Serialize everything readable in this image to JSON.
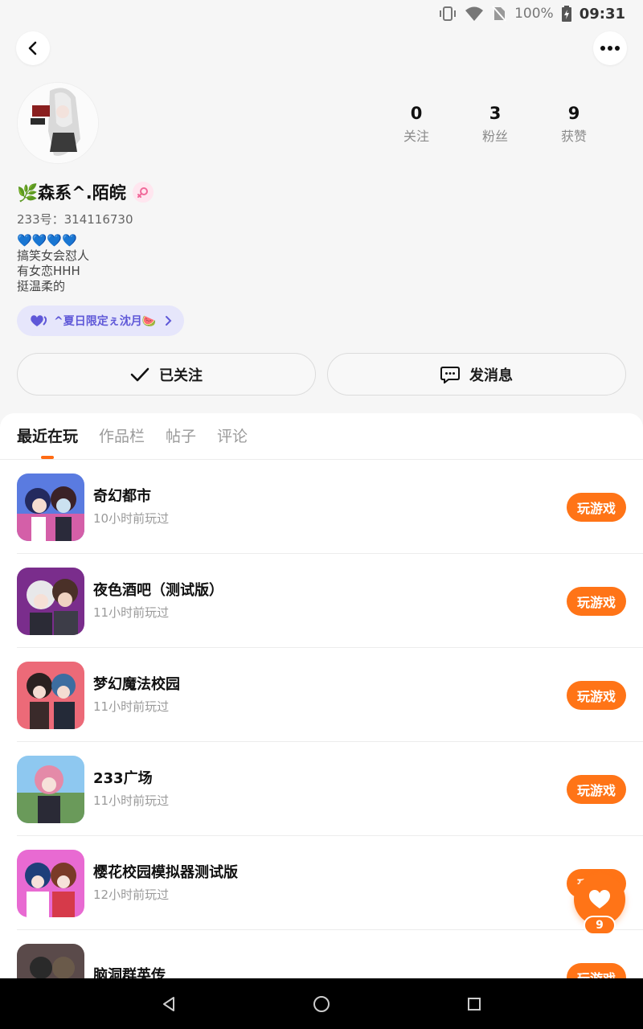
{
  "status_bar": {
    "battery": "100%",
    "time": "09:31"
  },
  "profile": {
    "nickname": "🌿森系^.陌皖",
    "uid": "233号：314116730",
    "bio_emoji": "💙💙💙💙",
    "bio_lines": [
      "搞笑女会怼人",
      "有女恋HHH",
      "挺温柔的"
    ],
    "tag": "^夏日限定ぇ沈月🍉",
    "stats": [
      {
        "num": "0",
        "label": "关注"
      },
      {
        "num": "3",
        "label": "粉丝"
      },
      {
        "num": "9",
        "label": "获赞"
      }
    ]
  },
  "actions": {
    "follow_label": "已关注",
    "message_label": "发消息"
  },
  "tabs": [
    {
      "label": "最近在玩",
      "active": true
    },
    {
      "label": "作品栏",
      "active": false
    },
    {
      "label": "帖子",
      "active": false
    },
    {
      "label": "评论",
      "active": false
    }
  ],
  "games": [
    {
      "name": "奇幻都市",
      "time": "10小时前玩过",
      "button": "玩游戏"
    },
    {
      "name": "夜色酒吧（测试版）",
      "time": "11小时前玩过",
      "button": "玩游戏"
    },
    {
      "name": "梦幻魔法校园",
      "time": "11小时前玩过",
      "button": "玩游戏"
    },
    {
      "name": "233广场",
      "time": "11小时前玩过",
      "button": "玩游戏"
    },
    {
      "name": "樱花校园模拟器测试版",
      "time": "12小时前玩过",
      "button": "玩游戏"
    },
    {
      "name": "脑洞群英传",
      "time": "",
      "button": "玩游戏"
    }
  ],
  "like_fab": {
    "count": "9"
  },
  "colors": {
    "accent": "#ff7417",
    "tag_bg": "#e6e6fb",
    "tag_text": "#5f58d8"
  }
}
